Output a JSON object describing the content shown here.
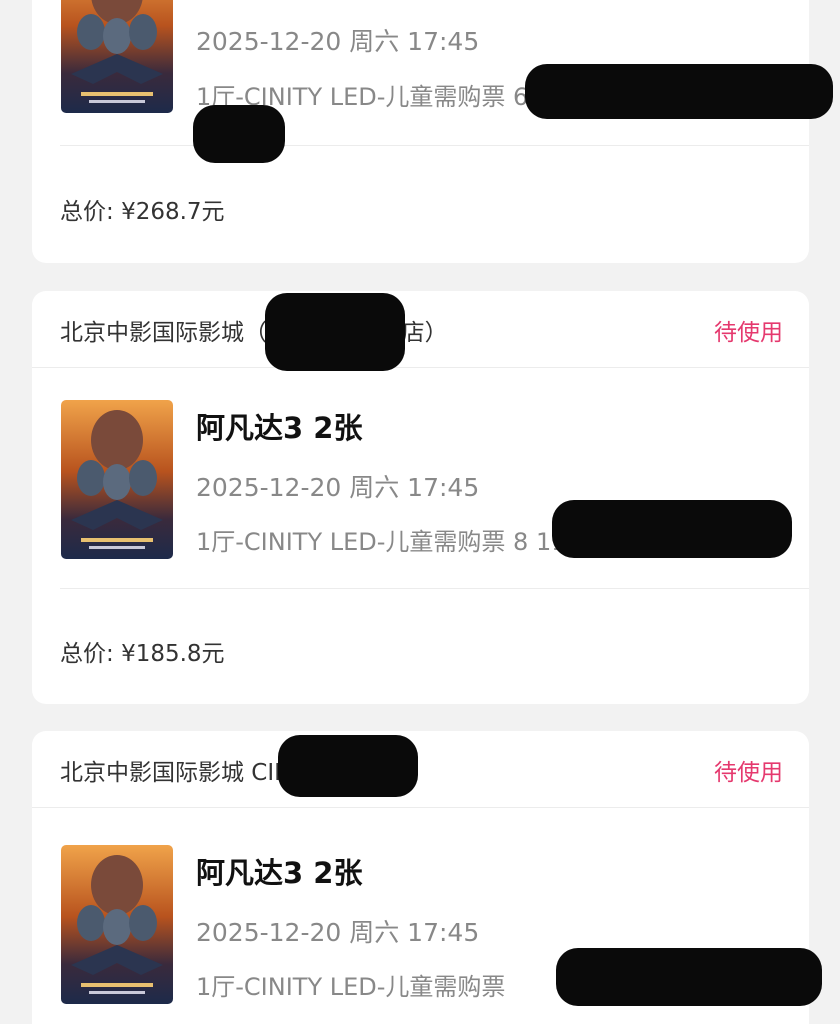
{
  "orders": [
    {
      "time": "2025-12-20 周六 17:45",
      "hall": "1厅-CINITY LED-儿童需购票 6排",
      "total_label": "总价:",
      "total_value": "¥268.7元"
    },
    {
      "cinema": "北京中影国际影城（ CINITY LED店）",
      "status": "待使用",
      "title": "阿凡达3 2张",
      "time": "2025-12-20 周六 17:45",
      "hall": "1厅-CINITY LED-儿童需购票 8 11座",
      "total_label": "总价:",
      "total_value": "¥185.8元"
    },
    {
      "cinema": "北京中影国际影城 CINITY LED店）",
      "status": "待使用",
      "title": "阿凡达3 2张",
      "time": "2025-12-20 周六 17:45",
      "hall": "1厅-CINITY LED-儿童需购票"
    }
  ]
}
